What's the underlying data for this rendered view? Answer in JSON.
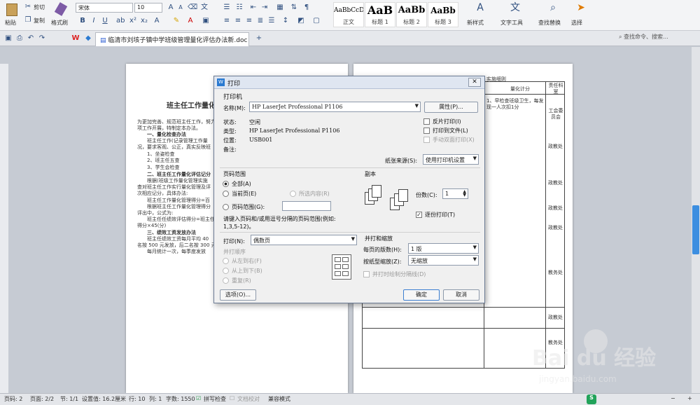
{
  "ribbon": {
    "paste": "粘贴",
    "cut": "剪切",
    "copy": "复制",
    "format_painter": "格式刷",
    "font_name": "宋体",
    "font_size": "10",
    "styles": [
      {
        "sample": "AaBbCcD",
        "label": "正文"
      },
      {
        "sample": "AaB",
        "label": "标题 1"
      },
      {
        "sample": "AaBb",
        "label": "标题 2"
      },
      {
        "sample": "AaBb",
        "label": "标题 3"
      }
    ],
    "new_style": "新样式",
    "text_tools": "文字工具",
    "find_replace": "查找替换",
    "select": "选择"
  },
  "doc_tab": {
    "title": "临清市刘垓子镇中学班级管理量化评估办法新.doc *"
  },
  "search": {
    "placeholder": "查找命令、搜索..."
  },
  "page1": {
    "title": "班主任工作量化",
    "lines": [
      "为更加完善、规范班主任工作，努力",
      "项工作开展，特制定本办法。",
      "一、量化检查办法",
      "班主任工作(记录管理工作量",
      "况，要求客观、公正，真实反映班",
      "1、坐姿检查",
      "2、班主任五查",
      "3、学生会检查",
      "二、班主任工作量化评估记分",
      "根据(班级工作量化管理实施",
      "查对班主任工作实行量化管理及评",
      "次相应记分，具体办法:",
      "班主任工作量化管理得分=百",
      "根据班主任工作量化管理得分",
      "评出中，公式为:",
      "班主任任绩效评估得分=班主任",
      "得分×45(分)",
      "三、绩效工资发放办法",
      "班主任绩效工资每月平均 40",
      "名按 500 元发放，后二名按 300 元",
      "每月统计一次，每季度发放"
    ]
  },
  "page2": {
    "header": "实施细则",
    "cells": [
      "量化计分",
      "责任科室",
      "1、早检查班级卫生，每发现一人次扣1分",
      "工会委员会",
      "政教处",
      "政教处",
      "政教处",
      "政教处",
      "教务处",
      "政教处",
      "教务处"
    ]
  },
  "dialog": {
    "title": "打印",
    "printer_section": "打印机",
    "name_label": "名称(M):",
    "printer_name": "HP LaserJet Professional P1106",
    "properties_btn": "属性(P)...",
    "status_label": "状态:",
    "status_value": "空闲",
    "type_label": "类型:",
    "type_value": "HP LaserJet Professional P1106",
    "location_label": "位置:",
    "location_value": "USB001",
    "comment_label": "备注:",
    "reverse_print": "反片打印(I)",
    "print_to_file": "打印到文件(L)",
    "manual_duplex": "手动双面打印(X)",
    "paper_source_label": "纸张来源(S):",
    "paper_source_value": "使用打印机设置",
    "range_section": "页码范围",
    "all": "全部(A)",
    "current_page": "当前页(E)",
    "selection": "所选内容(R)",
    "page_range": "页码范围(G):",
    "range_hint": "请键入页码和/或用逗号分隔的页码范围(例如:",
    "range_example": "1,3,5-12)。",
    "copies_section": "副本",
    "copies_label": "份数(C):",
    "copies_value": "1",
    "collate": "逐份打印(T)",
    "print_what_label": "打印(N):",
    "print_what_value": "偶数页",
    "order_section": "并打顺序",
    "left_to_right": "从左到右(F)",
    "top_to_bottom": "从上到下(B)",
    "repeat": "重复(R)",
    "zoom_section": "并打和缩放",
    "pages_per_sheet_label": "每页的版数(H):",
    "pages_per_sheet_value": "1 版",
    "scale_label": "按纸型缩放(Z):",
    "scale_value": "无缩放",
    "draw_borders": "并打时绘制分隔线(D)",
    "options_btn": "选项(O)...",
    "ok_btn": "确定",
    "cancel_btn": "取消"
  },
  "status": {
    "page_no": "页码: 2",
    "pages": "页面: 2/2",
    "section": "节: 1/1",
    "setting": "设置值: 16.2厘米",
    "row": "行: 10",
    "col": "列: 1",
    "words": "字数: 1550",
    "spell": "拼写检查",
    "proofread": "文档校对",
    "compat": "兼容模式"
  },
  "watermark": {
    "text": "Bai du 经验",
    "url": "jingyan.baidu.com"
  }
}
